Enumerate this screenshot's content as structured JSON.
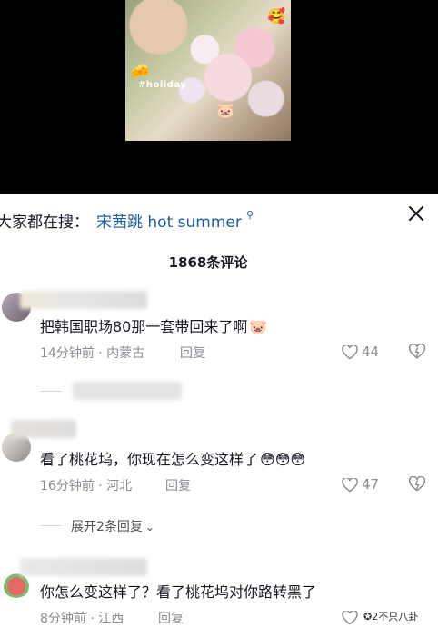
{
  "video": {
    "thumbnail_caption": "#holiday"
  },
  "search": {
    "prefix": "大家都在搜：",
    "query": "宋茜跳 hot summer",
    "icon": "search-icon"
  },
  "header": {
    "comment_count": "1868条评论",
    "close_icon": "close-icon"
  },
  "comments": [
    {
      "text": "把韩国职场80那一套带回来了啊",
      "emojis": "🐷",
      "time_location": "14分钟前 · 内蒙古",
      "reply": "回复",
      "likes": "44"
    },
    {
      "text": "看了桃花坞，你现在怎么变这样了",
      "emojis": "😳😳😳",
      "time_location": "16分钟前 · 河北",
      "reply": "回复",
      "likes": "47",
      "expand": "展开2条回复"
    },
    {
      "text": "你怎么变这样了？看了桃花坞对你路转黑了",
      "emojis": "",
      "time_location": "8分钟前 · 江西",
      "reply": "回复",
      "likes": ""
    }
  ],
  "watermark": "2不只八卦",
  "colors": {
    "link": "#1c5ea8",
    "meta": "#8a8b91",
    "text": "#161823"
  }
}
